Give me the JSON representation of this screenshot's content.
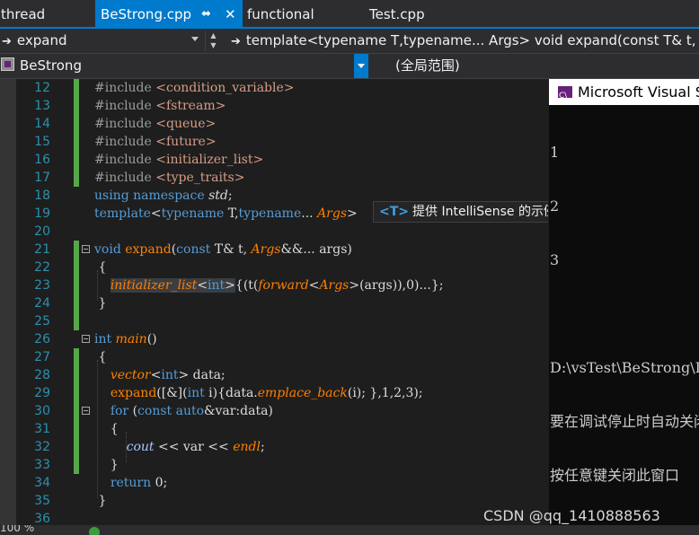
{
  "tabs": {
    "thread": "thread",
    "active": "BeStrong.cpp",
    "functional": "functional",
    "test": "Test.cpp",
    "pin_icon": "pin-icon",
    "close_icon": "close-icon"
  },
  "nav": {
    "function_scope": "expand",
    "member": "template<typename T,typename... Args> void expand(const T& t, Ar",
    "project": "BeStrong",
    "global_scope": "(全局范围)"
  },
  "editor": {
    "line_numbers": [
      "12",
      "13",
      "14",
      "15",
      "16",
      "17",
      "18",
      "19",
      "20",
      "21",
      "22",
      "23",
      "24",
      "25",
      "26",
      "27",
      "28",
      "29",
      "30",
      "31",
      "32",
      "33",
      "34",
      "35",
      "36"
    ],
    "intellisense_badge": "<T>",
    "intellisense_text": "提供 IntelliSense 的示例"
  },
  "console": {
    "title": "Microsoft Visual Studio 调试控制台",
    "lines": [
      "1",
      "2",
      "3",
      "",
      "D:\\vsTest\\BeStrong\\Debug\\BeStrong.exe",
      "要在调试停止时自动关闭控制台",
      "按任意键关闭此窗口"
    ]
  },
  "status": {
    "zoom": "100 %",
    "ok_icon": "check-circle-icon"
  },
  "watermark": "CSDN @qq_1410888563",
  "colors": {
    "accent": "#007acc",
    "change_bar": "#57a64a",
    "keyword": "#569cd6",
    "function": "#ff8000"
  }
}
